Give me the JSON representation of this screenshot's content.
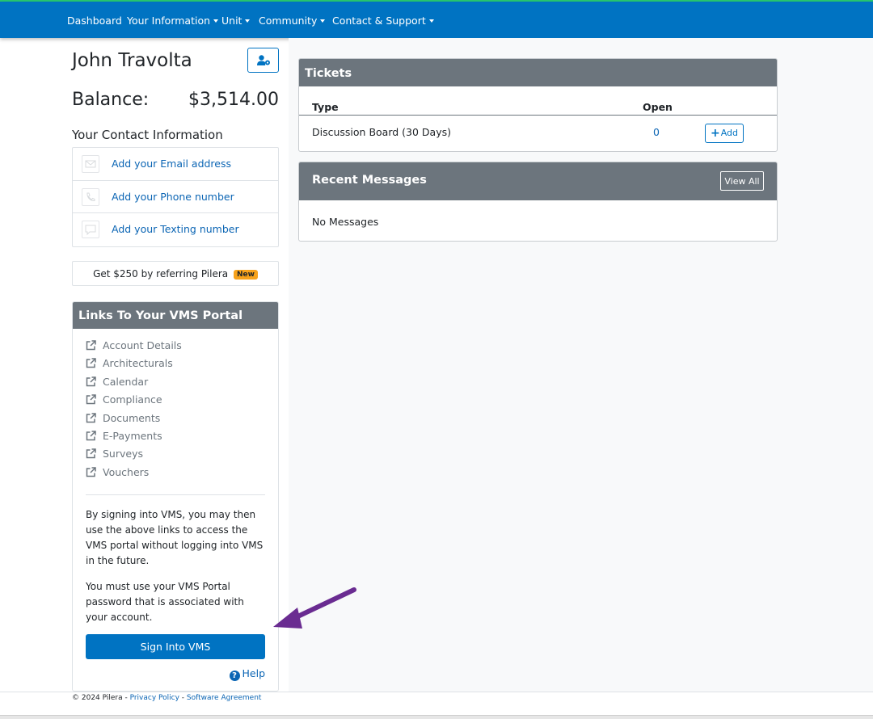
{
  "nav": {
    "items": [
      {
        "label": "Dashboard",
        "dropdown": false
      },
      {
        "label": "Your Information",
        "dropdown": true
      },
      {
        "label": "Unit",
        "dropdown": true
      },
      {
        "label": "Community",
        "dropdown": true
      },
      {
        "label": "Contact & Support",
        "dropdown": true
      }
    ]
  },
  "profile": {
    "name": "John Travolta",
    "balance_label": "Balance:",
    "balance_value": "$3,514.00",
    "profile_settings_icon": "user-gear-icon"
  },
  "contact": {
    "heading": "Your Contact Information",
    "items": [
      {
        "label": "Add your Email address",
        "icon": "envelope-icon"
      },
      {
        "label": "Add your Phone number",
        "icon": "phone-icon"
      },
      {
        "label": "Add your Texting number",
        "icon": "message-icon"
      }
    ]
  },
  "referral": {
    "text": "Get $250 by referring Pilera",
    "badge": "New",
    "badge_color": "#f7a21b"
  },
  "vms": {
    "title": "Links To Your VMS Portal",
    "links": [
      "Account Details",
      "Architecturals",
      "Calendar",
      "Compliance",
      "Documents",
      "E-Payments",
      "Surveys",
      "Vouchers"
    ],
    "info1": "By signing into VMS, you may then use the above links to access the VMS portal without logging into VMS in the future.",
    "info2": "You must use your VMS Portal password that is associated with your account.",
    "sign_in_label": "Sign Into VMS",
    "help_label": "Help"
  },
  "tickets": {
    "title": "Tickets",
    "columns": [
      "Type",
      "Open"
    ],
    "rows": [
      {
        "type": "Discussion Board (30 Days)",
        "open": "0",
        "action": "Add"
      }
    ]
  },
  "messages": {
    "title": "Recent Messages",
    "view_all": "View All",
    "empty_text": "No Messages"
  },
  "footer": {
    "copyright": "© 2024 Pilera - ",
    "privacy": "Privacy Policy",
    "separator": " - ",
    "agreement": "Software Agreement"
  },
  "colors": {
    "navbar": "#0073c2",
    "card_header": "#6c757d",
    "link": "#0b65b4",
    "annotation_arrow": "#6a2c91"
  }
}
